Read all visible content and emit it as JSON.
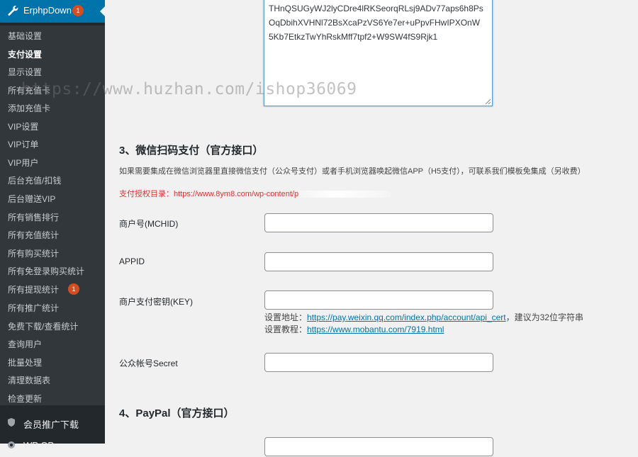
{
  "sidebar": {
    "top_item": {
      "label": "ErphpDown",
      "badge": "1"
    },
    "items": [
      {
        "label": "基础设置"
      },
      {
        "label": "支付设置"
      },
      {
        "label": "显示设置"
      },
      {
        "label": "所有充值卡"
      },
      {
        "label": "添加充值卡"
      },
      {
        "label": "VIP设置"
      },
      {
        "label": "VIP订单"
      },
      {
        "label": "VIP用户"
      },
      {
        "label": "后台充值/扣钱"
      },
      {
        "label": "后台赠送VIP"
      },
      {
        "label": "所有销售排行"
      },
      {
        "label": "所有充值统计"
      },
      {
        "label": "所有购买统计"
      },
      {
        "label": "所有免登录购买统计"
      },
      {
        "label": "所有提现统计",
        "badge": "1"
      },
      {
        "label": "所有推广统计"
      },
      {
        "label": "免费下载/查看统计"
      },
      {
        "label": "查询用户"
      },
      {
        "label": "批量处理"
      },
      {
        "label": "清理数据表"
      },
      {
        "label": "检查更新"
      }
    ],
    "main_items": [
      {
        "label": "会员推广下载"
      },
      {
        "label": "WP OP..."
      }
    ]
  },
  "textarea": {
    "lines": [
      "THnQSUGyWJ2lyCDre4lRKSeorqRLsj9ADv77aps6h8Ps",
      "OqDbihXVHNl72BsXcaPzVS6Ye7er+uPpvFHwIPXOnW",
      "5Kb7EtkzTwYhRskMff7tpf2+W9SW4fS9Rjk1"
    ]
  },
  "wechat": {
    "title": "3、微信扫码支付（官方接口）",
    "description": "如果需要集成在微信浏览器里直接微信支付（公众号支付）或者手机浏览器唤起微信APP（H5支付），可联系我们模板免集成（另收费）",
    "auth_prefix": "支付授权目录：https://www.8ym8.com/wp-content/p",
    "fields": {
      "mchid_label": "商户号(MCHID)",
      "appid_label": "APPID",
      "key_label": "商户支付密钥(KEY)",
      "secret_label": "公众帐号Secret"
    },
    "help": {
      "line1_prefix": "设置地址：",
      "line1_link": "https://pay.weixin.qq.com/index.php/account/api_cert",
      "line1_suffix": "，建议为32位字符串",
      "line2_prefix": "设置教程：",
      "line2_link": "https://www.mobantu.com/7919.html"
    }
  },
  "paypal": {
    "title": "4、PayPal（官方接口）"
  },
  "watermark": "https://www.huzhan.com/ishop36069",
  "colors": {
    "sidebar_bg": "#23282d",
    "submenu_bg": "#32373c",
    "accent": "#0073aa",
    "badge": "#d54e21",
    "auth_text": "#dc3232"
  }
}
